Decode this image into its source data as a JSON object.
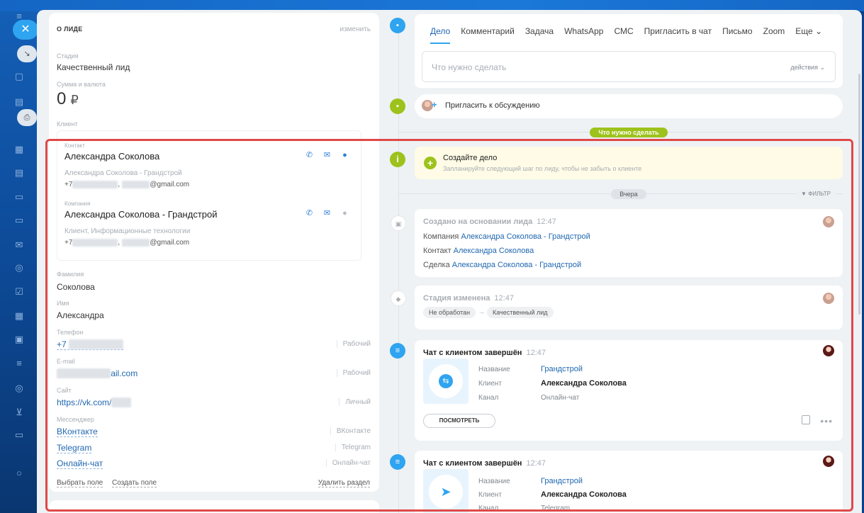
{
  "lead": {
    "section_title": "О ЛИДЕ",
    "edit": "изменить",
    "stage_label": "Стадия",
    "stage_value": "Качественный лид",
    "sum_label": "Сумма и валюта",
    "sum_value": "0",
    "currency": "₽",
    "client_label": "Клиент",
    "contact_label": "Контакт",
    "contact_name": "Александра Соколова",
    "contact_sub": "Александра Соколова - Грандстрой",
    "contact_phone": "+7",
    "contact_email": "@gmail.com",
    "company_label": "Компания",
    "company_name": "Александра Соколова - Грандстрой",
    "company_sub": "Клиент, Информационные технологии",
    "company_phone": "+7",
    "company_email": "@gmail.com",
    "lastname_label": "Фамилия",
    "lastname_value": "Соколова",
    "name_label": "Имя",
    "name_value": "Александра",
    "phone_label": "Телефон",
    "phone_value": "+7",
    "phone_type": "Рабочий",
    "email_label": "E-mail",
    "email_value": "ail.com",
    "email_type": "Рабочий",
    "site_label": "Сайт",
    "site_value": "https://vk.com/",
    "site_type": "Личный",
    "messenger_label": "Мессенджер",
    "messengers": [
      {
        "label": "ВКонтакте",
        "type": "ВКонтакте"
      },
      {
        "label": "Telegram",
        "type": "Telegram"
      },
      {
        "label": "Онлайн-чат",
        "type": "Онлайн-чат"
      }
    ],
    "choose_field": "Выбрать поле",
    "create_field": "Создать поле",
    "delete_section": "Удалить раздел"
  },
  "tabs": [
    "Дело",
    "Комментарий",
    "Задача",
    "WhatsApp",
    "СМС",
    "Пригласить в чат",
    "Письмо",
    "Zoom",
    "Еще"
  ],
  "todo": {
    "placeholder": "Что нужно сделать",
    "actions": "действия"
  },
  "invite": "Пригласить к обсуждению",
  "todo_pill": "Что нужно сделать",
  "create_task": {
    "title": "Создайте дело",
    "subtitle": "Запланируйте следующий шаг по лиду, чтобы не забыть о клиенте"
  },
  "yesterday": "Вчера",
  "filter": "ФИЛЬТР",
  "events": {
    "created": {
      "title": "Создано на основании лида",
      "time": "12:47",
      "company_label": "Компания",
      "company_link": "Александра Соколова - Грандстрой",
      "contact_label": "Контакт",
      "contact_link": "Александра Соколова",
      "deal_label": "Сделка",
      "deal_link": "Александра Соколова - Грандстрой"
    },
    "stage": {
      "title": "Стадия изменена",
      "time": "12:47",
      "from": "Не обработан",
      "arrow": "→",
      "to": "Качественный лид"
    },
    "chat1": {
      "title": "Чат с клиентом завершён",
      "time": "12:47",
      "name_label": "Название",
      "name_value": "Грандстрой",
      "client_label": "Клиент",
      "client_value": "Александра Соколова",
      "channel_label": "Канал",
      "channel_value": "Онлайн-чат",
      "view": "ПОСМОТРЕТЬ"
    },
    "chat2": {
      "title": "Чат с клиентом завершён",
      "time": "12:47",
      "name_label": "Название",
      "name_value": "Грандстрой",
      "client_label": "Клиент",
      "client_value": "Александра Соколова",
      "channel_label": "Канал",
      "channel_value": "Telegram"
    }
  },
  "colors": {
    "accent": "#2fa4f0",
    "green": "#9dc21c",
    "link": "#2067b0",
    "highlight": "#e04848"
  }
}
